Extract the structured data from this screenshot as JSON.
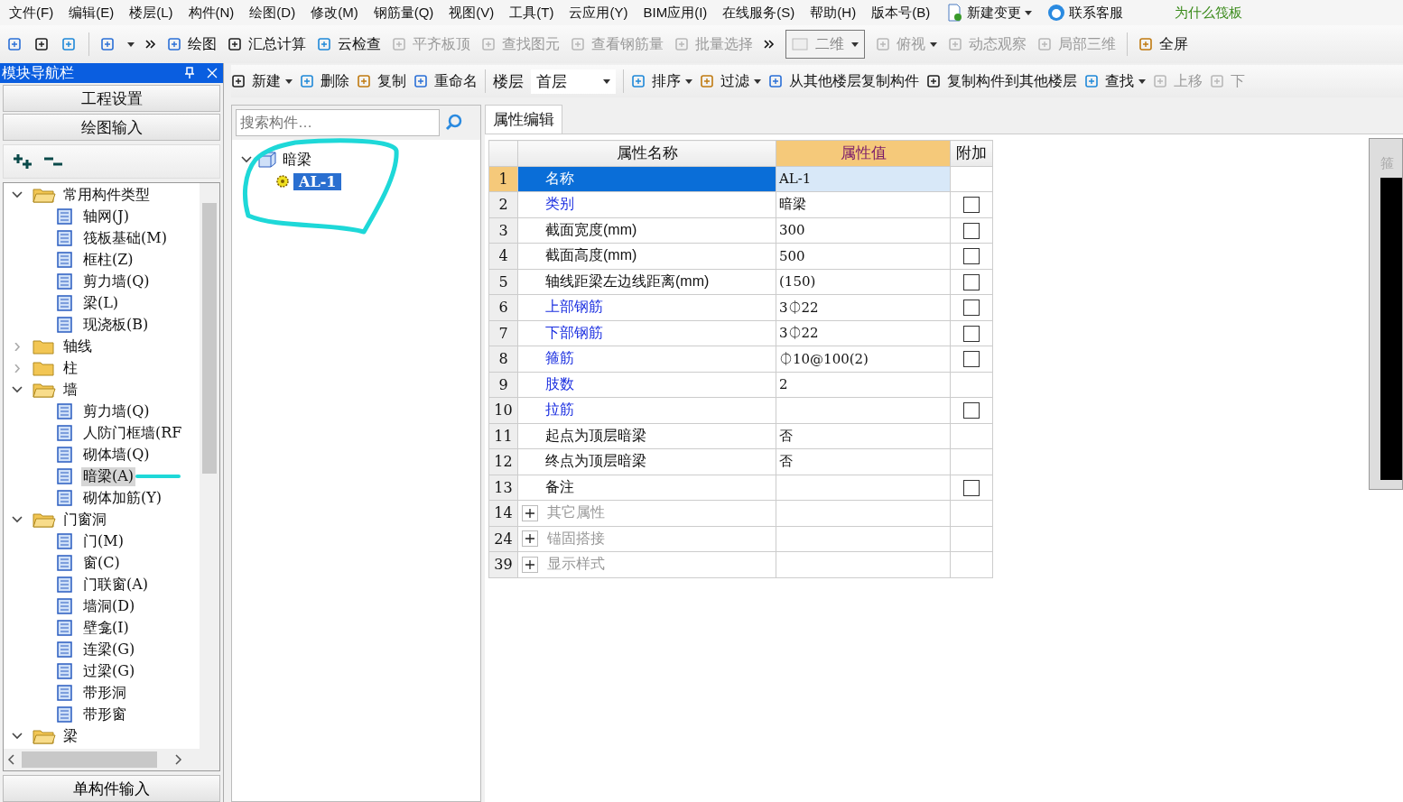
{
  "menu": [
    "文件(F)",
    "编辑(E)",
    "楼层(L)",
    "构件(N)",
    "绘图(D)",
    "修改(M)",
    "钢筋量(Q)",
    "视图(V)",
    "工具(T)",
    "云应用(Y)",
    "BIM应用(I)",
    "在线服务(S)",
    "帮助(H)",
    "版本号(B)"
  ],
  "menu_extras": [
    {
      "label": "新建变更",
      "dropdown": true
    },
    {
      "label": "联系客服",
      "dropdown": false
    }
  ],
  "notice": "为什么筏板",
  "toolbar": [
    {
      "label": "绘图",
      "disabled": false
    },
    {
      "label": "汇总计算",
      "disabled": false
    },
    {
      "label": "云检查",
      "disabled": false
    },
    {
      "label": "平齐板顶",
      "disabled": true
    },
    {
      "label": "查找图元",
      "disabled": true
    },
    {
      "label": "查看钢筋量",
      "disabled": true
    },
    {
      "label": "批量选择",
      "disabled": true
    }
  ],
  "view_mode": {
    "value": "二维"
  },
  "view_tools": [
    {
      "label": "俯视",
      "disabled": true,
      "dropdown": true
    },
    {
      "label": "动态观察",
      "disabled": true,
      "dropdown": false
    },
    {
      "label": "局部三维",
      "disabled": true,
      "dropdown": false
    },
    {
      "label": "全屏",
      "disabled": false,
      "dropdown": false
    }
  ],
  "navigator": {
    "title": "模块导航栏",
    "sections": [
      "工程设置",
      "绘图输入"
    ],
    "bottom_section": "单构件输入",
    "tree": [
      {
        "label": "常用构件类型",
        "expanded": true,
        "children": [
          {
            "label": "轴网(J)",
            "selected": false
          },
          {
            "label": "筏板基础(M)",
            "selected": false
          },
          {
            "label": "框柱(Z)",
            "selected": false
          },
          {
            "label": "剪力墙(Q)",
            "selected": false
          },
          {
            "label": "梁(L)",
            "selected": false
          },
          {
            "label": "现浇板(B)",
            "selected": false
          }
        ]
      },
      {
        "label": "轴线",
        "expanded": false
      },
      {
        "label": "柱",
        "expanded": false
      },
      {
        "label": "墙",
        "expanded": true,
        "children": [
          {
            "label": "剪力墙(Q)",
            "selected": false
          },
          {
            "label": "人防门框墙(RF",
            "selected": false
          },
          {
            "label": "砌体墙(Q)",
            "selected": false
          },
          {
            "label": "暗梁(A)",
            "selected": true
          },
          {
            "label": "砌体加筋(Y)",
            "selected": false
          }
        ]
      },
      {
        "label": "门窗洞",
        "expanded": true,
        "children": [
          {
            "label": "门(M)",
            "selected": false
          },
          {
            "label": "窗(C)",
            "selected": false
          },
          {
            "label": "门联窗(A)",
            "selected": false
          },
          {
            "label": "墙洞(D)",
            "selected": false
          },
          {
            "label": "壁龛(I)",
            "selected": false
          },
          {
            "label": "连梁(G)",
            "selected": false
          },
          {
            "label": "过梁(G)",
            "selected": false
          },
          {
            "label": "带形洞",
            "selected": false
          },
          {
            "label": "带形窗",
            "selected": false
          }
        ]
      },
      {
        "label": "梁",
        "expanded": true
      }
    ]
  },
  "component_toolbar": [
    {
      "label": "新建",
      "dropdown": true,
      "disabled": false
    },
    {
      "label": "删除",
      "dropdown": false,
      "disabled": false
    },
    {
      "label": "复制",
      "dropdown": false,
      "disabled": false
    },
    {
      "label": "重命名",
      "dropdown": false,
      "disabled": false
    }
  ],
  "floor": {
    "label": "楼层",
    "value": "首层"
  },
  "component_toolbar_2": [
    {
      "label": "排序",
      "dropdown": true,
      "disabled": false
    },
    {
      "label": "过滤",
      "dropdown": true,
      "disabled": false
    },
    {
      "label": "从其他楼层复制构件",
      "dropdown": false,
      "disabled": false
    },
    {
      "label": "复制构件到其他楼层",
      "dropdown": false,
      "disabled": false
    },
    {
      "label": "查找",
      "dropdown": true,
      "disabled": false
    },
    {
      "label": "上移",
      "dropdown": false,
      "disabled": true
    },
    {
      "label": "下",
      "dropdown": false,
      "disabled": true
    }
  ],
  "component_search": {
    "placeholder": "搜索构件…"
  },
  "component_tree": [
    {
      "label": "暗梁",
      "expanded": true,
      "children": [
        {
          "label": "AL-1",
          "selected": true
        }
      ]
    }
  ],
  "properties": {
    "tab": "属性编辑",
    "columns": [
      "属性名称",
      "属性值",
      "附加"
    ],
    "rows": [
      {
        "num": "1",
        "name": "名称",
        "value": "AL-1",
        "kind": "plain",
        "selected": true
      },
      {
        "num": "2",
        "name": "类别",
        "value": "暗梁",
        "kind": "link",
        "selected": false,
        "checked": false
      },
      {
        "num": "3",
        "name": "截面宽度(mm)",
        "value": "300",
        "kind": "plain",
        "selected": false,
        "checked": false
      },
      {
        "num": "4",
        "name": "截面高度(mm)",
        "value": "500",
        "kind": "plain",
        "selected": false,
        "checked": false
      },
      {
        "num": "5",
        "name": "轴线距梁左边线距离(mm)",
        "value": "(150)",
        "kind": "plain",
        "selected": false,
        "checked": false
      },
      {
        "num": "6",
        "name": "上部钢筋",
        "value": "3⏀22",
        "kind": "link",
        "selected": false,
        "checked": false
      },
      {
        "num": "7",
        "name": "下部钢筋",
        "value": "3⏀22",
        "kind": "link",
        "selected": false,
        "checked": false
      },
      {
        "num": "8",
        "name": "箍筋",
        "value": "⏀10@100(2)",
        "kind": "link",
        "selected": false,
        "checked": false
      },
      {
        "num": "9",
        "name": "肢数",
        "value": "2",
        "kind": "link",
        "selected": false
      },
      {
        "num": "10",
        "name": "拉筋",
        "kind": "link",
        "selected": false,
        "checked": false
      },
      {
        "num": "11",
        "name": "起点为顶层暗梁",
        "value": "否",
        "kind": "plain",
        "selected": false
      },
      {
        "num": "12",
        "name": "终点为顶层暗梁",
        "value": "否",
        "kind": "plain",
        "selected": false
      },
      {
        "num": "13",
        "name": "备注",
        "kind": "plain",
        "selected": false,
        "checked": false
      },
      {
        "num": "14",
        "name": "其它属性",
        "kind": "group",
        "selected": false
      },
      {
        "num": "24",
        "name": "锚固搭接",
        "kind": "group",
        "selected": false
      },
      {
        "num": "39",
        "name": "显示样式",
        "kind": "group",
        "selected": false
      }
    ]
  },
  "preview": {
    "title": "箍"
  }
}
